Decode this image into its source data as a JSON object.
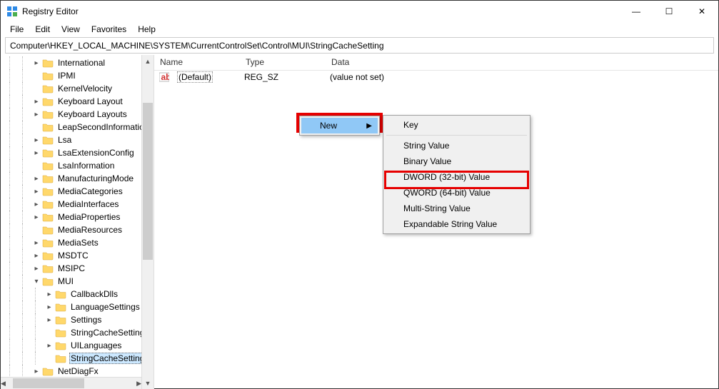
{
  "window_title": "Registry Editor",
  "window_controls": {
    "minimize": "—",
    "maximize": "☐",
    "close": "✕"
  },
  "menubar": [
    "File",
    "Edit",
    "View",
    "Favorites",
    "Help"
  ],
  "address_bar": "Computer\\HKEY_LOCAL_MACHINE\\SYSTEM\\CurrentControlSet\\Control\\MUI\\StringCacheSetting",
  "tree": [
    {
      "label": "International",
      "depth": 2,
      "expander": ">"
    },
    {
      "label": "IPMI",
      "depth": 2,
      "expander": ""
    },
    {
      "label": "KernelVelocity",
      "depth": 2,
      "expander": ""
    },
    {
      "label": "Keyboard Layout",
      "depth": 2,
      "expander": ">"
    },
    {
      "label": "Keyboard Layouts",
      "depth": 2,
      "expander": ">"
    },
    {
      "label": "LeapSecondInformation",
      "depth": 2,
      "expander": ""
    },
    {
      "label": "Lsa",
      "depth": 2,
      "expander": ">"
    },
    {
      "label": "LsaExtensionConfig",
      "depth": 2,
      "expander": ">"
    },
    {
      "label": "LsaInformation",
      "depth": 2,
      "expander": ""
    },
    {
      "label": "ManufacturingMode",
      "depth": 2,
      "expander": ">"
    },
    {
      "label": "MediaCategories",
      "depth": 2,
      "expander": ">"
    },
    {
      "label": "MediaInterfaces",
      "depth": 2,
      "expander": ">"
    },
    {
      "label": "MediaProperties",
      "depth": 2,
      "expander": ">"
    },
    {
      "label": "MediaResources",
      "depth": 2,
      "expander": ""
    },
    {
      "label": "MediaSets",
      "depth": 2,
      "expander": ">"
    },
    {
      "label": "MSDTC",
      "depth": 2,
      "expander": ">"
    },
    {
      "label": "MSIPC",
      "depth": 2,
      "expander": ">"
    },
    {
      "label": "MUI",
      "depth": 2,
      "expander": "v"
    },
    {
      "label": "CallbackDlls",
      "depth": 3,
      "expander": ">"
    },
    {
      "label": "LanguageSettings",
      "depth": 3,
      "expander": ">"
    },
    {
      "label": "Settings",
      "depth": 3,
      "expander": ">"
    },
    {
      "label": "StringCacheSettings",
      "depth": 3,
      "expander": ""
    },
    {
      "label": "UILanguages",
      "depth": 3,
      "expander": ">"
    },
    {
      "label": "StringCacheSetting",
      "depth": 3,
      "expander": "",
      "selected": true
    },
    {
      "label": "NetDiagFx",
      "depth": 2,
      "expander": ">"
    }
  ],
  "list": {
    "columns": {
      "name": "Name",
      "type": "Type",
      "data": "Data"
    },
    "rows": [
      {
        "name": "(Default)",
        "type": "REG_SZ",
        "data": "(value not set)"
      }
    ]
  },
  "context_menu_new": {
    "label": "New"
  },
  "context_submenu": [
    "Key",
    "---",
    "String Value",
    "Binary Value",
    "DWORD (32-bit) Value",
    "QWORD (64-bit) Value",
    "Multi-String Value",
    "Expandable String Value"
  ]
}
